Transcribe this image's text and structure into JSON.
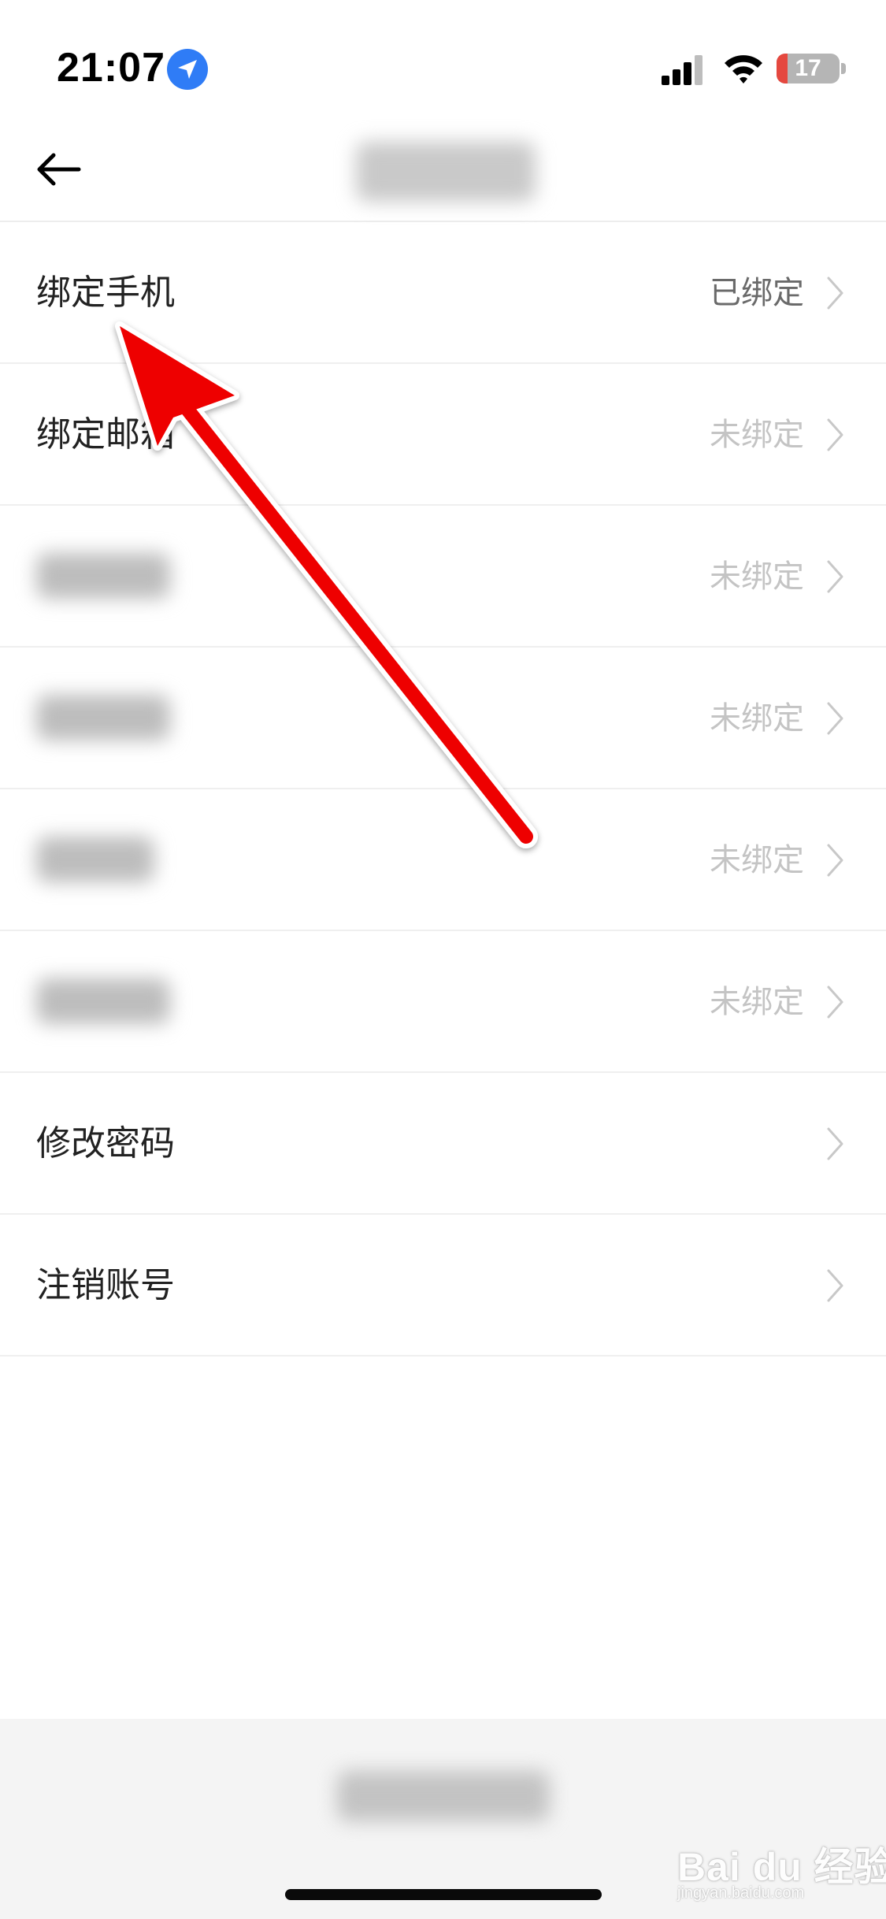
{
  "status_bar": {
    "time": "21:07",
    "battery_level": "17",
    "battery_fraction": 0.17,
    "location_icon": "location-arrow-icon",
    "signal_icon": "cellular-signal-icon",
    "wifi_icon": "wifi-icon"
  },
  "nav": {
    "back_icon": "arrow-left-icon",
    "title_blurred": true
  },
  "rows": [
    {
      "label": "绑定手机",
      "value": "已绑定",
      "status": "bound"
    },
    {
      "label": "绑定邮箱",
      "value": "未绑定",
      "status": "unbound"
    },
    {
      "label": "",
      "value": "未绑定",
      "status": "unbound",
      "blurred": true
    },
    {
      "label": "",
      "value": "未绑定",
      "status": "unbound",
      "blurred": true
    },
    {
      "label": "",
      "value": "未绑定",
      "status": "unbound",
      "blurred": true
    },
    {
      "label": "",
      "value": "未绑定",
      "status": "unbound",
      "blurred": true
    },
    {
      "label": "修改密码",
      "value": "",
      "status": "none"
    },
    {
      "label": "注销账号",
      "value": "",
      "status": "none"
    }
  ],
  "bottom": {
    "action_blurred": true
  },
  "watermark": {
    "text": "Bai du 经验",
    "sub": "jingyan.baidu.com"
  },
  "colors": {
    "annotation_arrow": "#ee0000",
    "location_badge": "#2f7cf6",
    "battery_low": "#e5483f"
  }
}
